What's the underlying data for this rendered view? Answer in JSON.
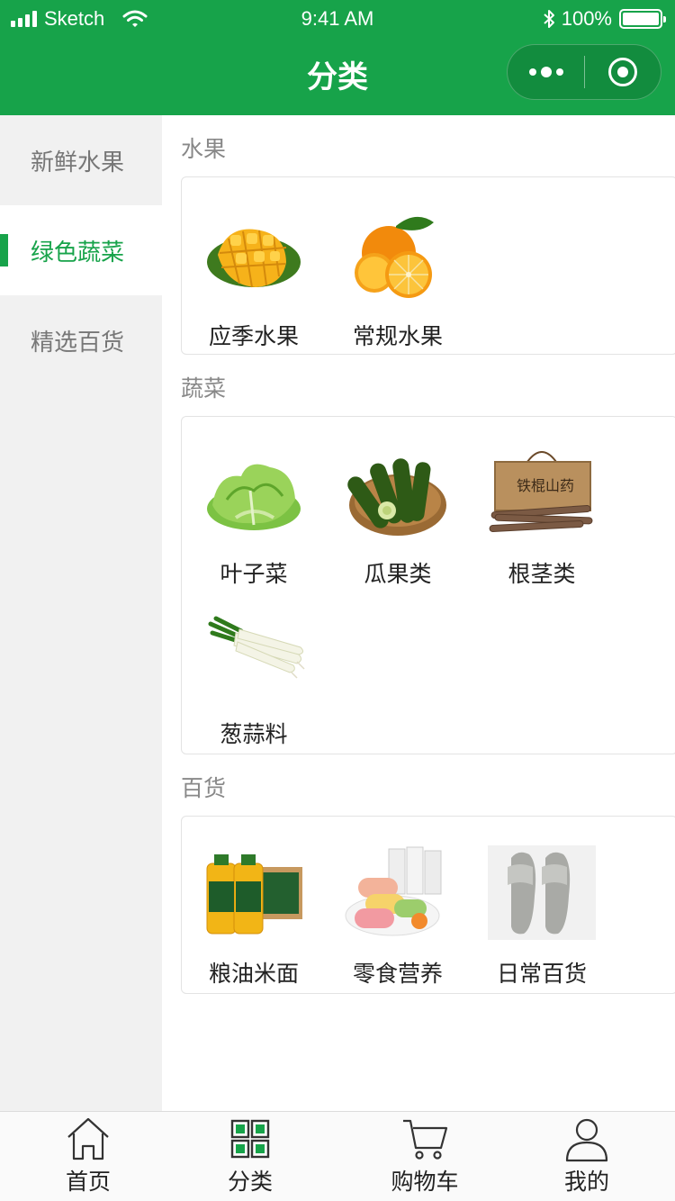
{
  "status_bar": {
    "carrier": "Sketch",
    "time": "9:41 AM",
    "battery": "100%"
  },
  "nav": {
    "title": "分类",
    "more_icon": "more-dots-icon",
    "close_icon": "target-close-icon"
  },
  "colors": {
    "brand": "#17a34a",
    "sidebar_bg": "#f1f1f1",
    "active_text": "#17a34a"
  },
  "sidebar": {
    "items": [
      {
        "label": "新鲜水果",
        "active": false
      },
      {
        "label": "绿色蔬菜",
        "active": true
      },
      {
        "label": "精选百货",
        "active": false
      }
    ]
  },
  "sections": [
    {
      "title": "水果",
      "items": [
        {
          "label": "应季水果",
          "icon": "mango-image"
        },
        {
          "label": "常规水果",
          "icon": "orange-image"
        }
      ]
    },
    {
      "title": "蔬菜",
      "items": [
        {
          "label": "叶子菜",
          "icon": "lettuce-image"
        },
        {
          "label": "瓜果类",
          "icon": "cucumber-basket-image"
        },
        {
          "label": "根茎类",
          "icon": "yam-box-image"
        },
        {
          "label": "葱蒜料",
          "icon": "scallion-image"
        }
      ]
    },
    {
      "title": "百货",
      "items": [
        {
          "label": "粮油米面",
          "icon": "cooking-oil-image"
        },
        {
          "label": "零食营养",
          "icon": "snack-rolls-image"
        },
        {
          "label": "日常百货",
          "icon": "slippers-image"
        }
      ]
    }
  ],
  "tabbar": {
    "tabs": [
      {
        "label": "首页",
        "icon": "home-icon",
        "active": false
      },
      {
        "label": "分类",
        "icon": "category-grid-icon",
        "active": true
      },
      {
        "label": "购物车",
        "icon": "cart-icon",
        "active": false
      },
      {
        "label": "我的",
        "icon": "user-icon",
        "active": false
      }
    ]
  }
}
